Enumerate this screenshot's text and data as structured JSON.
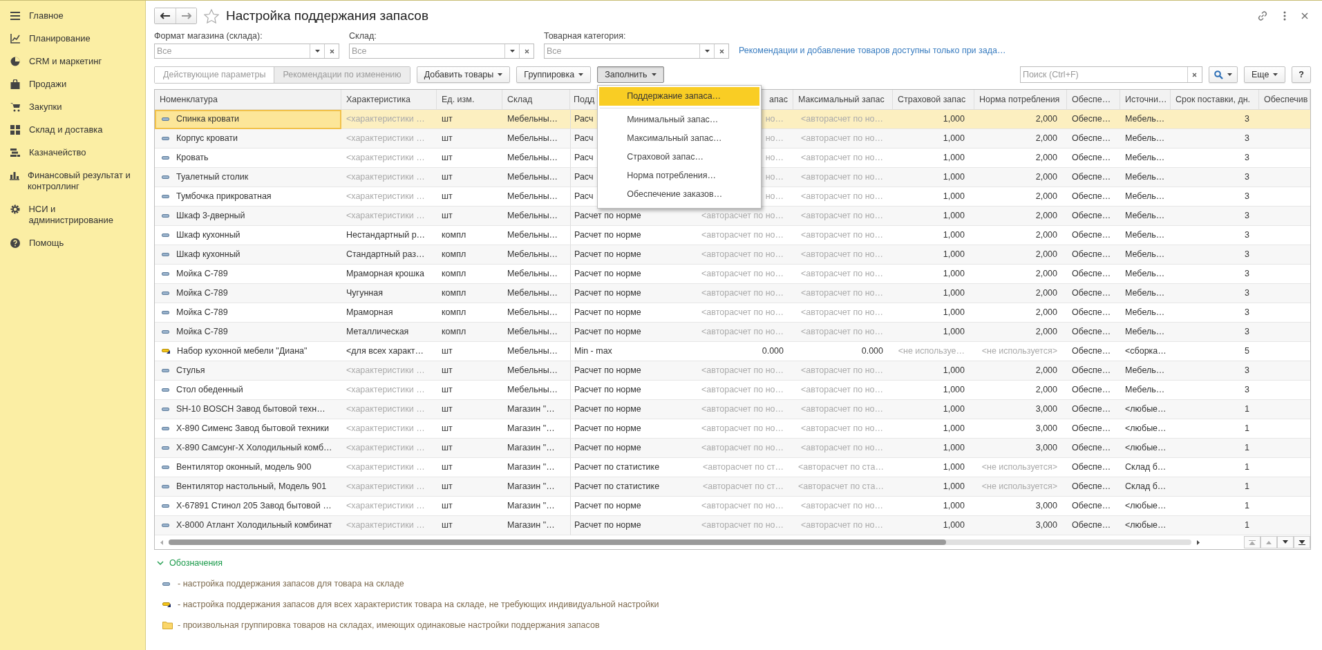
{
  "sidebar": {
    "items": [
      {
        "label": "Главное"
      },
      {
        "label": "Планирование"
      },
      {
        "label": "CRM и маркетинг"
      },
      {
        "label": "Продажи"
      },
      {
        "label": "Закупки"
      },
      {
        "label": "Склад и доставка"
      },
      {
        "label": "Казначейство"
      },
      {
        "label": "Финансовый результат и контроллинг"
      },
      {
        "label": "НСИ и администрирование"
      },
      {
        "label": "Помощь"
      }
    ]
  },
  "window": {
    "title": "Настройка поддержания запасов"
  },
  "filters": [
    {
      "label": "Формат магазина (склада):",
      "placeholder": "Все"
    },
    {
      "label": "Склад:",
      "placeholder": "Все"
    },
    {
      "label": "Товарная категория:",
      "placeholder": "Все"
    }
  ],
  "notice_link": "Рекомендации и добавление товаров доступны только при зада…",
  "mode_buttons": [
    {
      "label": "Действующие параметры",
      "selected": false
    },
    {
      "label": "Рекомендации по изменению",
      "selected": true
    }
  ],
  "toolbar_buttons": [
    {
      "label": "Добавить товары",
      "pressed": false
    },
    {
      "label": "Группировка",
      "pressed": false
    },
    {
      "label": "Заполнить",
      "pressed": true
    }
  ],
  "fill_menu": [
    {
      "kind": "item",
      "label": "Поддержание запаса…",
      "selected": true
    },
    {
      "kind": "separator"
    },
    {
      "kind": "item",
      "label": "Минимальный запас…",
      "selected": false
    },
    {
      "kind": "item",
      "label": "Максимальный запас…",
      "selected": false
    },
    {
      "kind": "item",
      "label": "Страховой запас…",
      "selected": false
    },
    {
      "kind": "item",
      "label": "Норма потребления…",
      "selected": false
    },
    {
      "kind": "item",
      "label": "Обеспечение заказов…",
      "selected": false
    }
  ],
  "search": {
    "placeholder": "Поиск (Ctrl+F)"
  },
  "more_button": "Еще",
  "help_button": "?",
  "table": {
    "columns": [
      "Номенклатура",
      "Характеристика",
      "Ед. изм.",
      "Склад",
      "Подд",
      "апас",
      "Максимальный запас",
      "Страховой запас",
      "Норма потребления",
      "Обеспе…",
      "Источни…",
      "Срок поставки, дн.",
      "Обеспечив"
    ],
    "rows": [
      {
        "kind": "item",
        "selected": true,
        "cells": [
          "Спинка кровати",
          "<характеристики …",
          "шт",
          "Мебельны…",
          "Расч",
          "но…",
          "<авторасчет по но…",
          "1,000",
          "2,000",
          "Обеспе…",
          "Мебель…",
          "3"
        ],
        "muted": [
          false,
          true,
          false,
          false,
          false,
          true,
          true,
          false,
          false,
          false,
          false,
          false
        ]
      },
      {
        "kind": "item",
        "selected": false,
        "cells": [
          "Корпус кровати",
          "<характеристики …",
          "шт",
          "Мебельны…",
          "Расч",
          "но…",
          "<авторасчет по но…",
          "1,000",
          "2,000",
          "Обеспе…",
          "Мебель…",
          "3"
        ],
        "muted": [
          false,
          true,
          false,
          false,
          false,
          true,
          true,
          false,
          false,
          false,
          false,
          false
        ]
      },
      {
        "kind": "item",
        "selected": false,
        "cells": [
          "Кровать",
          "<характеристики …",
          "шт",
          "Мебельны…",
          "Расч",
          "но…",
          "<авторасчет по но…",
          "1,000",
          "2,000",
          "Обеспе…",
          "Мебель…",
          "3"
        ],
        "muted": [
          false,
          true,
          false,
          false,
          false,
          true,
          true,
          false,
          false,
          false,
          false,
          false
        ]
      },
      {
        "kind": "item",
        "selected": false,
        "cells": [
          "Туалетный столик",
          "<характеристики …",
          "шт",
          "Мебельны…",
          "Расч",
          "но…",
          "<авторасчет по но…",
          "1,000",
          "2,000",
          "Обеспе…",
          "Мебель…",
          "3"
        ],
        "muted": [
          false,
          true,
          false,
          false,
          false,
          true,
          true,
          false,
          false,
          false,
          false,
          false
        ]
      },
      {
        "kind": "item",
        "selected": false,
        "cells": [
          "Тумбочка прикроватная",
          "<характеристики …",
          "шт",
          "Мебельны…",
          "Расч",
          "но…",
          "<авторасчет по но…",
          "1,000",
          "2,000",
          "Обеспе…",
          "Мебель…",
          "3"
        ],
        "muted": [
          false,
          true,
          false,
          false,
          false,
          true,
          true,
          false,
          false,
          false,
          false,
          false
        ]
      },
      {
        "kind": "item",
        "selected": false,
        "cells": [
          "Шкаф 3-дверный",
          "<характеристики …",
          "шт",
          "Мебельны…",
          "Расчет по норме",
          "<авторасчет по но…",
          "<авторасчет по но…",
          "1,000",
          "2,000",
          "Обеспе…",
          "Мебель…",
          "3"
        ],
        "muted": [
          false,
          true,
          false,
          false,
          false,
          true,
          true,
          false,
          false,
          false,
          false,
          false
        ]
      },
      {
        "kind": "item",
        "selected": false,
        "cells": [
          "Шкаф кухонный",
          "Нестандартный р…",
          "компл",
          "Мебельны…",
          "Расчет по норме",
          "<авторасчет по но…",
          "<авторасчет по но…",
          "1,000",
          "2,000",
          "Обеспе…",
          "Мебель…",
          "3"
        ],
        "muted": [
          false,
          false,
          false,
          false,
          false,
          true,
          true,
          false,
          false,
          false,
          false,
          false
        ]
      },
      {
        "kind": "item",
        "selected": false,
        "cells": [
          "Шкаф кухонный",
          "Стандартный раз…",
          "компл",
          "Мебельны…",
          "Расчет по норме",
          "<авторасчет по но…",
          "<авторасчет по но…",
          "1,000",
          "2,000",
          "Обеспе…",
          "Мебель…",
          "3"
        ],
        "muted": [
          false,
          false,
          false,
          false,
          false,
          true,
          true,
          false,
          false,
          false,
          false,
          false
        ]
      },
      {
        "kind": "item",
        "selected": false,
        "cells": [
          "Мойка С-789",
          "Мраморная крошка",
          "компл",
          "Мебельны…",
          "Расчет по норме",
          "<авторасчет по но…",
          "<авторасчет по но…",
          "1,000",
          "2,000",
          "Обеспе…",
          "Мебель…",
          "3"
        ],
        "muted": [
          false,
          false,
          false,
          false,
          false,
          true,
          true,
          false,
          false,
          false,
          false,
          false
        ]
      },
      {
        "kind": "item",
        "selected": false,
        "cells": [
          "Мойка С-789",
          "Чугунная",
          "компл",
          "Мебельны…",
          "Расчет по норме",
          "<авторасчет по но…",
          "<авторасчет по но…",
          "1,000",
          "2,000",
          "Обеспе…",
          "Мебель…",
          "3"
        ],
        "muted": [
          false,
          false,
          false,
          false,
          false,
          true,
          true,
          false,
          false,
          false,
          false,
          false
        ]
      },
      {
        "kind": "item",
        "selected": false,
        "cells": [
          "Мойка С-789",
          "Мраморная",
          "компл",
          "Мебельны…",
          "Расчет по норме",
          "<авторасчет по но…",
          "<авторасчет по но…",
          "1,000",
          "2,000",
          "Обеспе…",
          "Мебель…",
          "3"
        ],
        "muted": [
          false,
          false,
          false,
          false,
          false,
          true,
          true,
          false,
          false,
          false,
          false,
          false
        ]
      },
      {
        "kind": "item",
        "selected": false,
        "cells": [
          "Мойка С-789",
          "Металлическая",
          "компл",
          "Мебельны…",
          "Расчет по норме",
          "<авторасчет по но…",
          "<авторасчет по но…",
          "1,000",
          "2,000",
          "Обеспе…",
          "Мебель…",
          "3"
        ],
        "muted": [
          false,
          false,
          false,
          false,
          false,
          true,
          true,
          false,
          false,
          false,
          false,
          false
        ]
      },
      {
        "kind": "all-chars",
        "selected": false,
        "cells": [
          "Набор кухонной мебели \"Диана\"",
          "<для всех характ…",
          "шт",
          "Мебельны…",
          "Min - max",
          "0.000",
          "0.000",
          "<не используе…",
          "<не используется>",
          "Обеспе…",
          "<сборка…",
          "5"
        ],
        "muted": [
          false,
          false,
          false,
          false,
          false,
          false,
          false,
          true,
          true,
          false,
          false,
          false
        ]
      },
      {
        "kind": "item",
        "selected": false,
        "cells": [
          "Стулья",
          "<характеристики …",
          "шт",
          "Мебельны…",
          "Расчет по норме",
          "<авторасчет по но…",
          "<авторасчет по но…",
          "1,000",
          "2,000",
          "Обеспе…",
          "Мебель…",
          "3"
        ],
        "muted": [
          false,
          true,
          false,
          false,
          false,
          true,
          true,
          false,
          false,
          false,
          false,
          false
        ]
      },
      {
        "kind": "item",
        "selected": false,
        "cells": [
          "Стол обеденный",
          "<характеристики …",
          "шт",
          "Мебельны…",
          "Расчет по норме",
          "<авторасчет по но…",
          "<авторасчет по но…",
          "1,000",
          "2,000",
          "Обеспе…",
          "Мебель…",
          "3"
        ],
        "muted": [
          false,
          true,
          false,
          false,
          false,
          true,
          true,
          false,
          false,
          false,
          false,
          false
        ]
      },
      {
        "kind": "item",
        "selected": false,
        "cells": [
          "SH-10 BOSCH Завод бытовой техн…",
          "<характеристики …",
          "шт",
          "Магазин \"…",
          "Расчет по норме",
          "<авторасчет по но…",
          "<авторасчет по но…",
          "1,000",
          "3,000",
          "Обеспе…",
          "<любые…",
          "1"
        ],
        "muted": [
          false,
          true,
          false,
          false,
          false,
          true,
          true,
          false,
          false,
          false,
          false,
          false
        ]
      },
      {
        "kind": "item",
        "selected": false,
        "cells": [
          "Х-890 Сименс Завод бытовой техники",
          "<характеристики …",
          "шт",
          "Магазин \"…",
          "Расчет по норме",
          "<авторасчет по но…",
          "<авторасчет по но…",
          "1,000",
          "3,000",
          "Обеспе…",
          "<любые…",
          "1"
        ],
        "muted": [
          false,
          true,
          false,
          false,
          false,
          true,
          true,
          false,
          false,
          false,
          false,
          false
        ]
      },
      {
        "kind": "item",
        "selected": false,
        "cells": [
          "Х-890 Самсунг-Х Холодильный комб…",
          "<характеристики …",
          "шт",
          "Магазин \"…",
          "Расчет по норме",
          "<авторасчет по но…",
          "<авторасчет по но…",
          "1,000",
          "3,000",
          "Обеспе…",
          "<любые…",
          "1"
        ],
        "muted": [
          false,
          true,
          false,
          false,
          false,
          true,
          true,
          false,
          false,
          false,
          false,
          false
        ]
      },
      {
        "kind": "item",
        "selected": false,
        "cells": [
          "Вентилятор оконный, модель 900",
          "<характеристики …",
          "шт",
          "Магазин \"…",
          "Расчет по статистике",
          "<авторасчет по ст…",
          "<авторасчет по ста…",
          "1,000",
          "<не используется>",
          "Обеспе…",
          "Склад б…",
          "1"
        ],
        "muted": [
          false,
          true,
          false,
          false,
          false,
          true,
          true,
          false,
          true,
          false,
          false,
          false
        ]
      },
      {
        "kind": "item",
        "selected": false,
        "cells": [
          "Вентилятор настольный, Модель 901",
          "<характеристики …",
          "шт",
          "Магазин \"…",
          "Расчет по статистике",
          "<авторасчет по ст…",
          "<авторасчет по ста…",
          "1,000",
          "<не используется>",
          "Обеспе…",
          "Склад б…",
          "1"
        ],
        "muted": [
          false,
          true,
          false,
          false,
          false,
          true,
          true,
          false,
          true,
          false,
          false,
          false
        ]
      },
      {
        "kind": "item",
        "selected": false,
        "cells": [
          "Х-67891 Стинол 205 Завод бытовой …",
          "<характеристики …",
          "шт",
          "Магазин \"…",
          "Расчет по норме",
          "<авторасчет по но…",
          "<авторасчет по но…",
          "1,000",
          "3,000",
          "Обеспе…",
          "<любые…",
          "1"
        ],
        "muted": [
          false,
          true,
          false,
          false,
          false,
          true,
          true,
          false,
          false,
          false,
          false,
          false
        ]
      },
      {
        "kind": "item",
        "selected": false,
        "cells": [
          "Х-8000 Атлант Холодильный комбинат",
          "<характеристики …",
          "шт",
          "Магазин \"…",
          "Расчет по норме",
          "<авторасчет по но…",
          "<авторасчет по но…",
          "1,000",
          "3,000",
          "Обеспе…",
          "<любые…",
          "1"
        ],
        "muted": [
          false,
          true,
          false,
          false,
          false,
          true,
          true,
          false,
          false,
          false,
          false,
          false
        ]
      }
    ]
  },
  "legend": {
    "title": "Обозначения",
    "expanded": true,
    "items": [
      {
        "kind": "item",
        "text": "- настройка поддержания запасов для товара на складе"
      },
      {
        "kind": "all-chars",
        "text": "- настройка поддержания запасов для всех характеристик товара на складе, не требующих индивидуальной настройки"
      },
      {
        "kind": "folder",
        "text": "- произвольная группировка товаров на складах, имеющих одинаковые настройки поддержания запасов"
      }
    ]
  }
}
